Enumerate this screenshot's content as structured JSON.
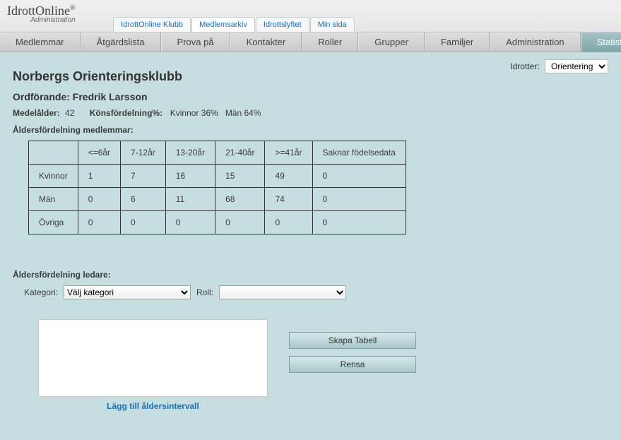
{
  "logo": {
    "main": "IdrottOnline",
    "reg": "®",
    "sub": "Administration"
  },
  "module_tabs": [
    {
      "label": "IdrottOnline Klubb",
      "active": false
    },
    {
      "label": "Medlemsarkiv",
      "active": true
    },
    {
      "label": "Idrottslyftet",
      "active": false
    },
    {
      "label": "Min sida",
      "active": false
    }
  ],
  "nav": [
    {
      "label": "Medlemmar",
      "active": false
    },
    {
      "label": "Åtgärdslista",
      "active": false
    },
    {
      "label": "Prova på",
      "active": false
    },
    {
      "label": "Kontakter",
      "active": false
    },
    {
      "label": "Roller",
      "active": false
    },
    {
      "label": "Grupper",
      "active": false
    },
    {
      "label": "Familjer",
      "active": false
    },
    {
      "label": "Administration",
      "active": false
    },
    {
      "label": "Statistik",
      "active": true
    }
  ],
  "idrotter": {
    "label": "Idrotter:",
    "value": "Orientering"
  },
  "club_name": "Norbergs Orienteringsklubb",
  "ordforande": {
    "label": "Ordförande:",
    "name": "Fredrik Larsson"
  },
  "avg_age": {
    "label": "Medelålder:",
    "value": "42"
  },
  "gender_pct": {
    "label": "Könsfördelning%:",
    "kvinnor_label": "Kvinnor",
    "kvinnor_pct": "36%",
    "man_label": "Män",
    "man_pct": "64%"
  },
  "age_table": {
    "title": "Åldersfördelning medlemmar:",
    "columns": [
      "<=6år",
      "7-12år",
      "13-20år",
      "21-40år",
      ">=41år",
      "Saknar födelsedata"
    ],
    "rows": [
      {
        "label": "Kvinnor",
        "cells": [
          "1",
          "7",
          "16",
          "15",
          "49",
          "0"
        ]
      },
      {
        "label": "Män",
        "cells": [
          "0",
          "6",
          "11",
          "68",
          "74",
          "0"
        ]
      },
      {
        "label": "Övriga",
        "cells": [
          "0",
          "0",
          "0",
          "0",
          "0",
          "0"
        ]
      }
    ]
  },
  "leaders": {
    "title": "Åldersfördelning ledare:",
    "kategori_label": "Kategori:",
    "kategori_value": "Välj kategori",
    "roll_label": "Roll:",
    "roll_value": ""
  },
  "buttons": {
    "skapa": "Skapa Tabell",
    "rensa": "Rensa"
  },
  "add_link": "Lägg till åldersintervall",
  "chart_data": {
    "type": "table",
    "title": "Åldersfördelning medlemmar",
    "categories": [
      "<=6år",
      "7-12år",
      "13-20år",
      "21-40år",
      ">=41år",
      "Saknar födelsedata"
    ],
    "series": [
      {
        "name": "Kvinnor",
        "values": [
          1,
          7,
          16,
          15,
          49,
          0
        ]
      },
      {
        "name": "Män",
        "values": [
          0,
          6,
          11,
          68,
          74,
          0
        ]
      },
      {
        "name": "Övriga",
        "values": [
          0,
          0,
          0,
          0,
          0,
          0
        ]
      }
    ]
  }
}
